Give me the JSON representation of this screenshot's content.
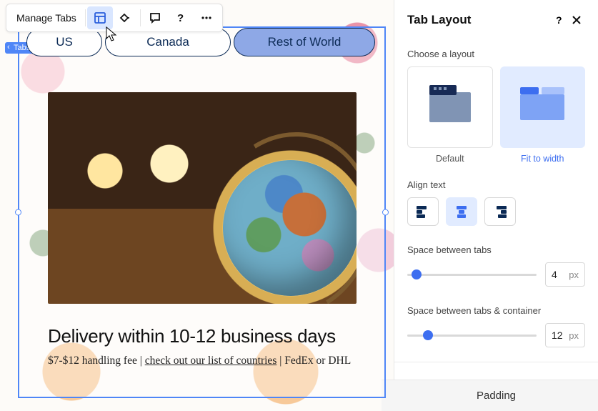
{
  "toolbar": {
    "manage_label": "Manage Tabs"
  },
  "selection_tag": "Tabs",
  "tabs": {
    "us": "US",
    "ca": "Canada",
    "row": "Rest of World"
  },
  "content": {
    "headline": "Delivery within 10-12 business days",
    "fee": "$7-$12 handling fee | ",
    "link": "check out our list of countries",
    "ship": " | FedEx or DHL"
  },
  "panel": {
    "title": "Tab Layout",
    "choose": "Choose a layout",
    "layout_default": "Default",
    "layout_fit": "Fit to width",
    "align_label": "Align text",
    "space_tabs_label": "Space between tabs",
    "space_tabs_value": "4",
    "space_cont_label": "Space between tabs & container",
    "space_cont_value": "12",
    "unit": "px",
    "padding": "Padding"
  }
}
